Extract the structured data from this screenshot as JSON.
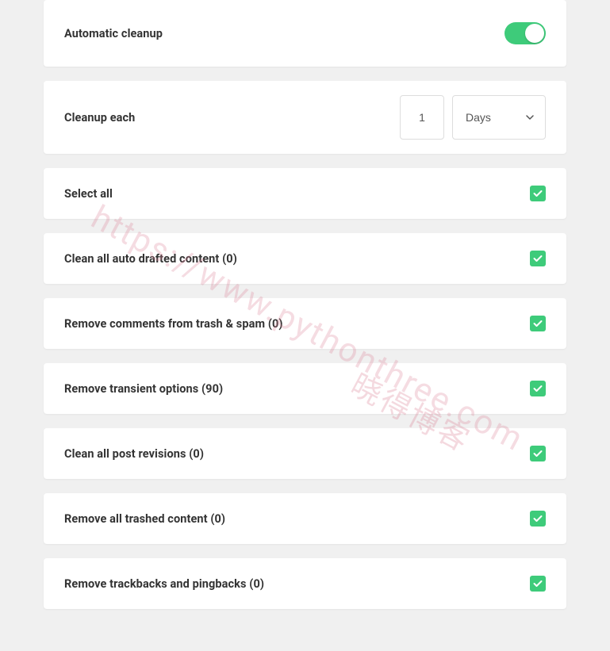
{
  "automatic_cleanup": {
    "label": "Automatic cleanup",
    "enabled": true
  },
  "cleanup_each": {
    "label": "Cleanup each",
    "value": "1",
    "unit": "Days"
  },
  "options": [
    {
      "label": "Select all",
      "checked": true
    },
    {
      "label": "Clean all auto drafted content (0)",
      "checked": true
    },
    {
      "label": "Remove comments from trash & spam (0)",
      "checked": true
    },
    {
      "label": "Remove transient options (90)",
      "checked": true
    },
    {
      "label": "Clean all post revisions (0)",
      "checked": true
    },
    {
      "label": "Remove all trashed content (0)",
      "checked": true
    },
    {
      "label": "Remove trackbacks and pingbacks (0)",
      "checked": true
    }
  ],
  "watermark": {
    "url": "https://www.pythonthree.com",
    "text": "晓得博客"
  }
}
